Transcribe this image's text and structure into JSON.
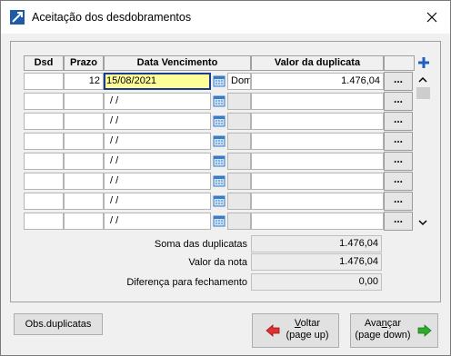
{
  "window": {
    "title": "Aceitação dos desdobramentos"
  },
  "grid": {
    "headers": {
      "dsd": "Dsd",
      "prazo": "Prazo",
      "data_vencimento": "Data Vencimento",
      "valor": "Valor da duplicata"
    },
    "rows": [
      {
        "dsd": "",
        "prazo": "12",
        "data": "15/08/2021",
        "dia": "Dom",
        "valor": "1.476,04",
        "action": "..."
      },
      {
        "dsd": "",
        "prazo": "",
        "data": "/ /",
        "dia": "",
        "valor": "",
        "action": "..."
      },
      {
        "dsd": "",
        "prazo": "",
        "data": "/ /",
        "dia": "",
        "valor": "",
        "action": "..."
      },
      {
        "dsd": "",
        "prazo": "",
        "data": "/ /",
        "dia": "",
        "valor": "",
        "action": "..."
      },
      {
        "dsd": "",
        "prazo": "",
        "data": "/ /",
        "dia": "",
        "valor": "",
        "action": "..."
      },
      {
        "dsd": "",
        "prazo": "",
        "data": "/ /",
        "dia": "",
        "valor": "",
        "action": "..."
      },
      {
        "dsd": "",
        "prazo": "",
        "data": "/ /",
        "dia": "",
        "valor": "",
        "action": "..."
      },
      {
        "dsd": "",
        "prazo": "",
        "data": "/ /",
        "dia": "",
        "valor": "",
        "action": "..."
      }
    ]
  },
  "summary": {
    "soma_label": "Soma das duplicatas",
    "soma_value": "1.476,04",
    "nota_label": "Valor da nota",
    "nota_value": "1.476,04",
    "diff_label": "Diferença para fechamento",
    "diff_value": "0,00"
  },
  "buttons": {
    "obs": "Obs.duplicatas",
    "back_line1_u": "V",
    "back_line1_rest": "oltar",
    "back_line2": "(page up)",
    "next_line1_pre": "Ava",
    "next_line1_u": "n",
    "next_line1_rest": "çar",
    "next_line2": "(page down)"
  },
  "colors": {
    "active_cell_bg": "#ffff99",
    "active_cell_border": "#1a3c8c",
    "plus_blue": "#1f5fbf",
    "back_arrow": "#e03030",
    "next_arrow": "#2faa2f"
  }
}
